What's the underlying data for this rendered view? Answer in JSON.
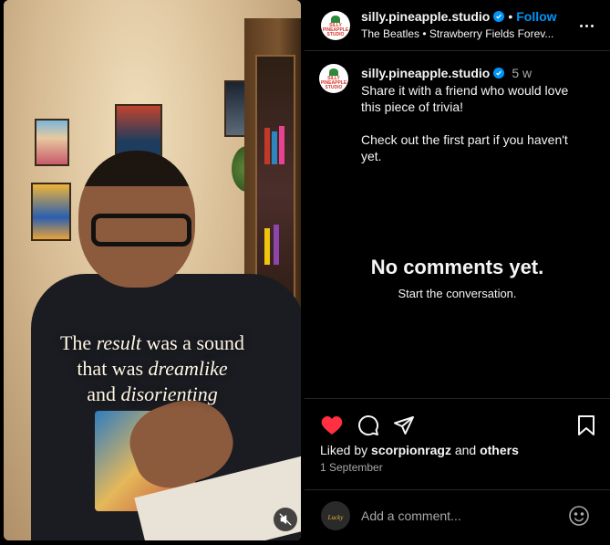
{
  "post": {
    "username": "silly.pineapple.studio",
    "follow_label": "Follow",
    "separator": "•",
    "audio_line": "The Beatles • Strawberry Fields Forev...",
    "avatar_text": "SILLY PINEAPPLE STUDIO"
  },
  "video": {
    "caption_line1_pre": "The ",
    "caption_line1_em": "result",
    "caption_line1_post": " was a sound",
    "caption_line2_pre": "that was ",
    "caption_line2_em": "dreamlike",
    "caption_line3_pre": "and ",
    "caption_line3_em": "disorienting",
    "muted": true
  },
  "caption": {
    "username": "silly.pineapple.studio",
    "time_ago": "5 w",
    "text": "Share it with a friend who would love this piece of trivia!\n\nCheck out the first part if you haven't yet."
  },
  "comments": {
    "empty_title": "No comments yet.",
    "empty_subtitle": "Start the conversation."
  },
  "engagement": {
    "liked_prefix": "Liked by ",
    "liked_user": "scorpionragz",
    "liked_and": " and ",
    "liked_others": "others",
    "date": "1 September",
    "liked": true,
    "heart_color": "#ff3040"
  },
  "comment_input": {
    "placeholder": "Add a comment..."
  },
  "icons": {
    "verified": "verified-badge-icon",
    "more": "more-options-icon",
    "heart": "heart-icon",
    "comment": "comment-icon",
    "share": "share-icon",
    "save": "bookmark-icon",
    "mute": "muted-speaker-icon",
    "emoji": "emoji-icon"
  }
}
